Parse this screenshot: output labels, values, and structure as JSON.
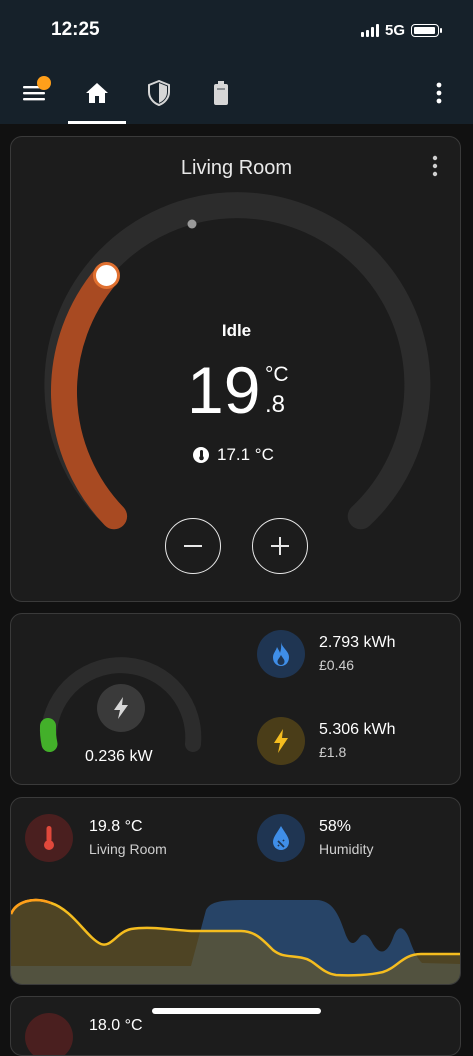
{
  "status": {
    "time": "12:25",
    "network": "5G"
  },
  "nav": {
    "icons": [
      "menu-icon",
      "home-icon",
      "shield-icon",
      "battery-icon",
      "more-vert-icon"
    ],
    "notification_color": "#ff9f1a"
  },
  "thermostat": {
    "title": "Living Room",
    "state": "Idle",
    "target_integer": "19",
    "target_decimal": ".8",
    "unit": "°C",
    "current_temp": "17.1 °C",
    "accent_color": "#a84a22",
    "minus_label": "−",
    "plus_label": "+"
  },
  "energy": {
    "power": "0.236 kW",
    "gas_energy": "2.793 kWh",
    "gas_cost": "£0.46",
    "electric_energy": "5.306 kWh",
    "electric_cost": "£1.8",
    "gauge_color": "#43b02a"
  },
  "climate": {
    "temperature": "19.8 °C",
    "temperature_label": "Living Room",
    "humidity": "58%",
    "humidity_label": "Humidity"
  },
  "next_card": {
    "value": "18.0 °C"
  }
}
